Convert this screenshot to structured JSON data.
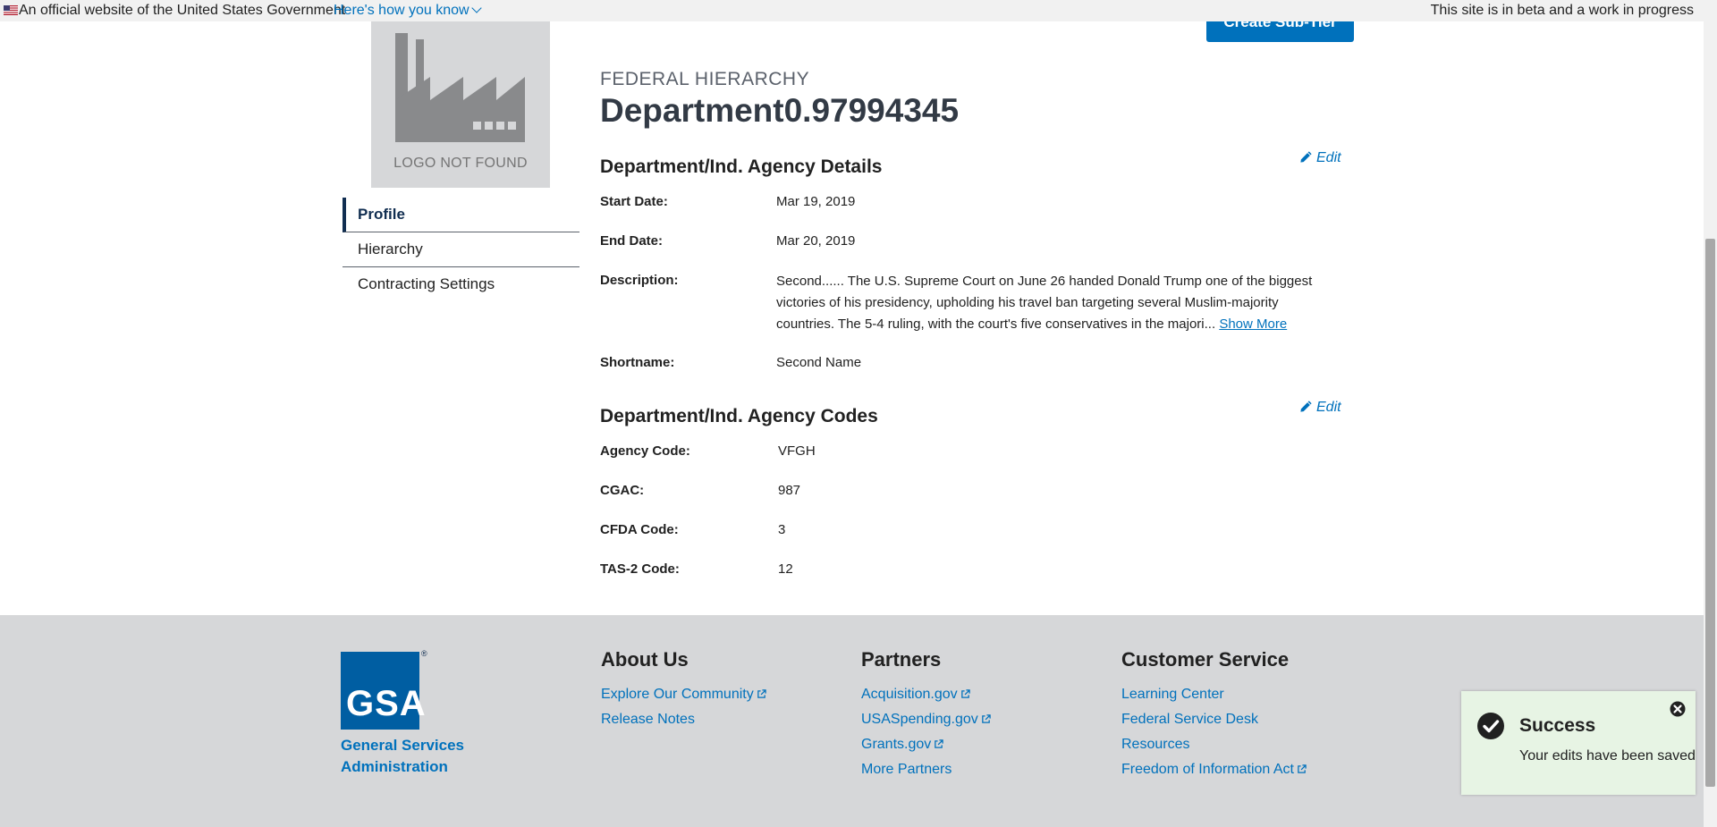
{
  "banner": {
    "official": "An official website of the United States Government",
    "howto": "Here's how you know",
    "beta": "This site is in beta and a work in progress"
  },
  "header": {
    "logo_text": "LOGO NOT FOUND",
    "create_button": "Create Sub-Tier",
    "eyebrow": "FEDERAL HIERARCHY",
    "title": "Department0.97994345"
  },
  "sidenav": {
    "items": [
      {
        "label": "Profile",
        "active": true
      },
      {
        "label": "Hierarchy"
      },
      {
        "label": "Contracting Settings"
      }
    ]
  },
  "details": {
    "title": "Department/Ind. Agency Details",
    "edit": "Edit",
    "start_label": "Start Date:",
    "start_value": "Mar 19, 2019",
    "end_label": "End Date:",
    "end_value": "Mar 20, 2019",
    "desc_label": "Description:",
    "desc_value": "Second...... The U.S. Supreme Court on June 26 handed Donald Trump one of the biggest victories of his presidency, upholding his travel ban targeting several Muslim-majority countries. The 5-4 ruling, with the court's five conservatives in the majori...",
    "show_more": "Show More",
    "short_label": "Shortname:",
    "short_value": "Second Name"
  },
  "codes": {
    "title": "Department/Ind. Agency Codes",
    "edit": "Edit",
    "agency_label": "Agency Code:",
    "agency_value": "VFGH",
    "cgac_label": "CGAC:",
    "cgac_value": "987",
    "cfda_label": "CFDA Code:",
    "cfda_value": "3",
    "tas_label": "TAS-2 Code:",
    "tas_value": "12"
  },
  "footer": {
    "logo_letters": "GSA",
    "org_line1": "General Services",
    "org_line2": "Administration",
    "about": {
      "title": "About Us",
      "links": [
        "Explore Our Community",
        "Release Notes"
      ]
    },
    "partners": {
      "title": "Partners",
      "links": [
        "Acquisition.gov",
        "USASpending.gov",
        "Grants.gov",
        "More Partners"
      ]
    },
    "service": {
      "title": "Customer Service",
      "links": [
        "Learning Center",
        "Federal Service Desk",
        "Resources",
        "Freedom of Information Act"
      ]
    }
  },
  "toast": {
    "title": "Success",
    "message": "Your edits have been saved"
  },
  "colors": {
    "primary": "#0071bc",
    "footer_bg": "#d6d7d9",
    "toast_bg": "#e7f4e4",
    "nav_active": "#112e51"
  }
}
